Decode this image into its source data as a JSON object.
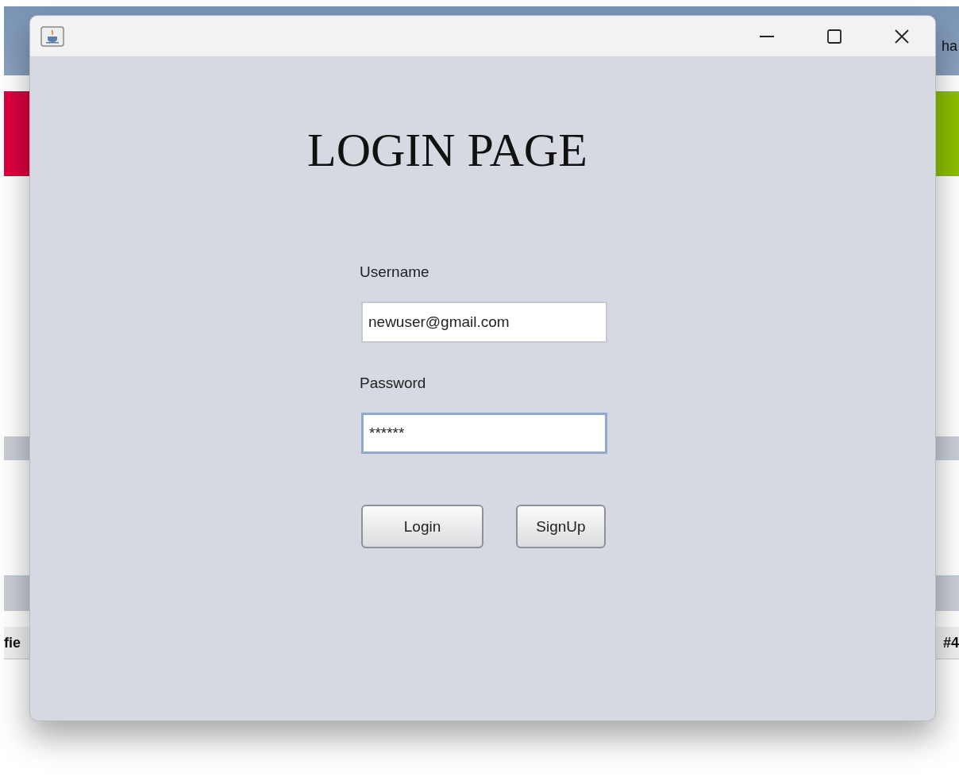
{
  "desktop": {
    "top_bar_text": "ha",
    "row_texts": [
      "fie",
      "#4"
    ]
  },
  "window": {
    "controls": [
      {
        "kind": "minimize"
      },
      {
        "kind": "maximize"
      },
      {
        "kind": "close"
      }
    ]
  },
  "heading": "LOGIN PAGE",
  "fields": [
    {
      "label": "Username",
      "value": "newuser@gmail.com",
      "focused": false
    },
    {
      "label": "Password",
      "value": "******",
      "focused": true
    }
  ],
  "buttons": [
    {
      "label": "Login"
    },
    {
      "label": "SignUp"
    }
  ]
}
